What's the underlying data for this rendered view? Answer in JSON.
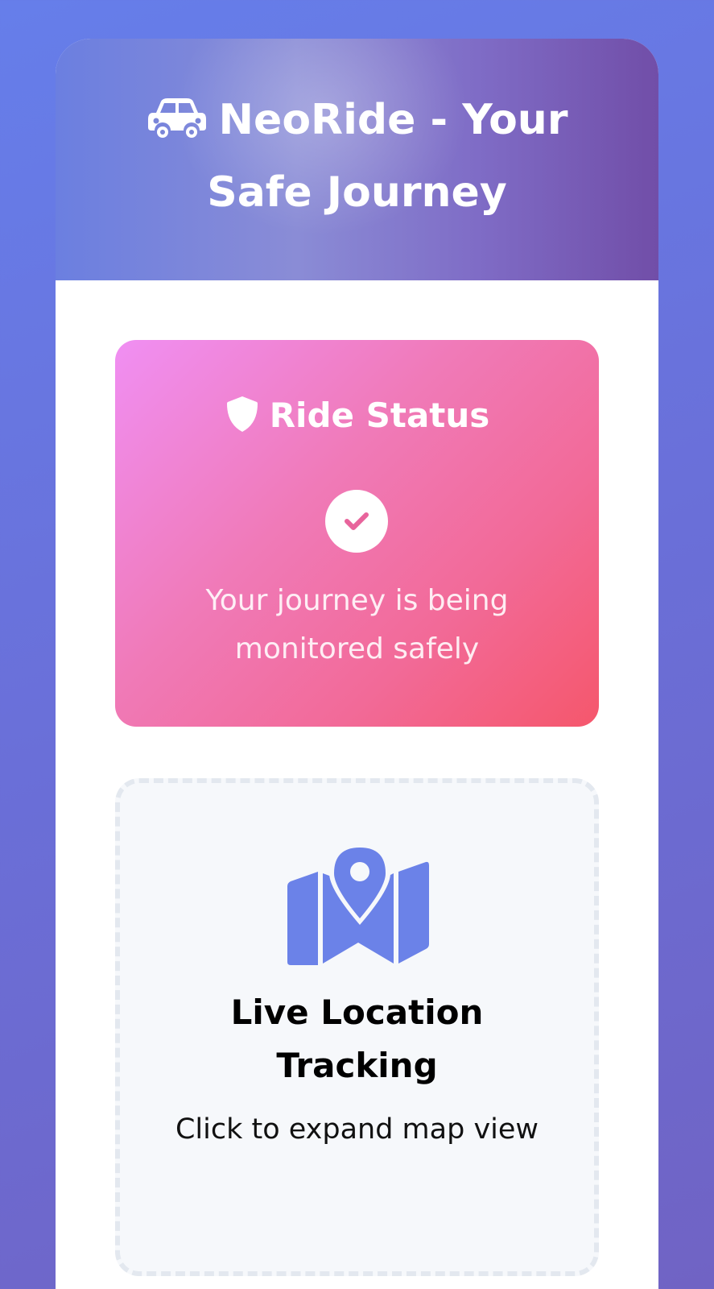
{
  "header": {
    "title": "NeoRide - Your Safe Journey",
    "icon": "car-icon"
  },
  "ride_status": {
    "heading": "Ride Status",
    "heading_icon": "shield-icon",
    "status_icon": "check-circle-icon",
    "message": "Your journey is being monitored safely"
  },
  "map_section": {
    "icon": "map-marker-icon",
    "title": "Live Location Tracking",
    "subtitle": "Click to expand map view"
  },
  "colors": {
    "accent": "#667eea",
    "status_gradient_start": "#f093fb",
    "status_gradient_end": "#f5576c"
  }
}
